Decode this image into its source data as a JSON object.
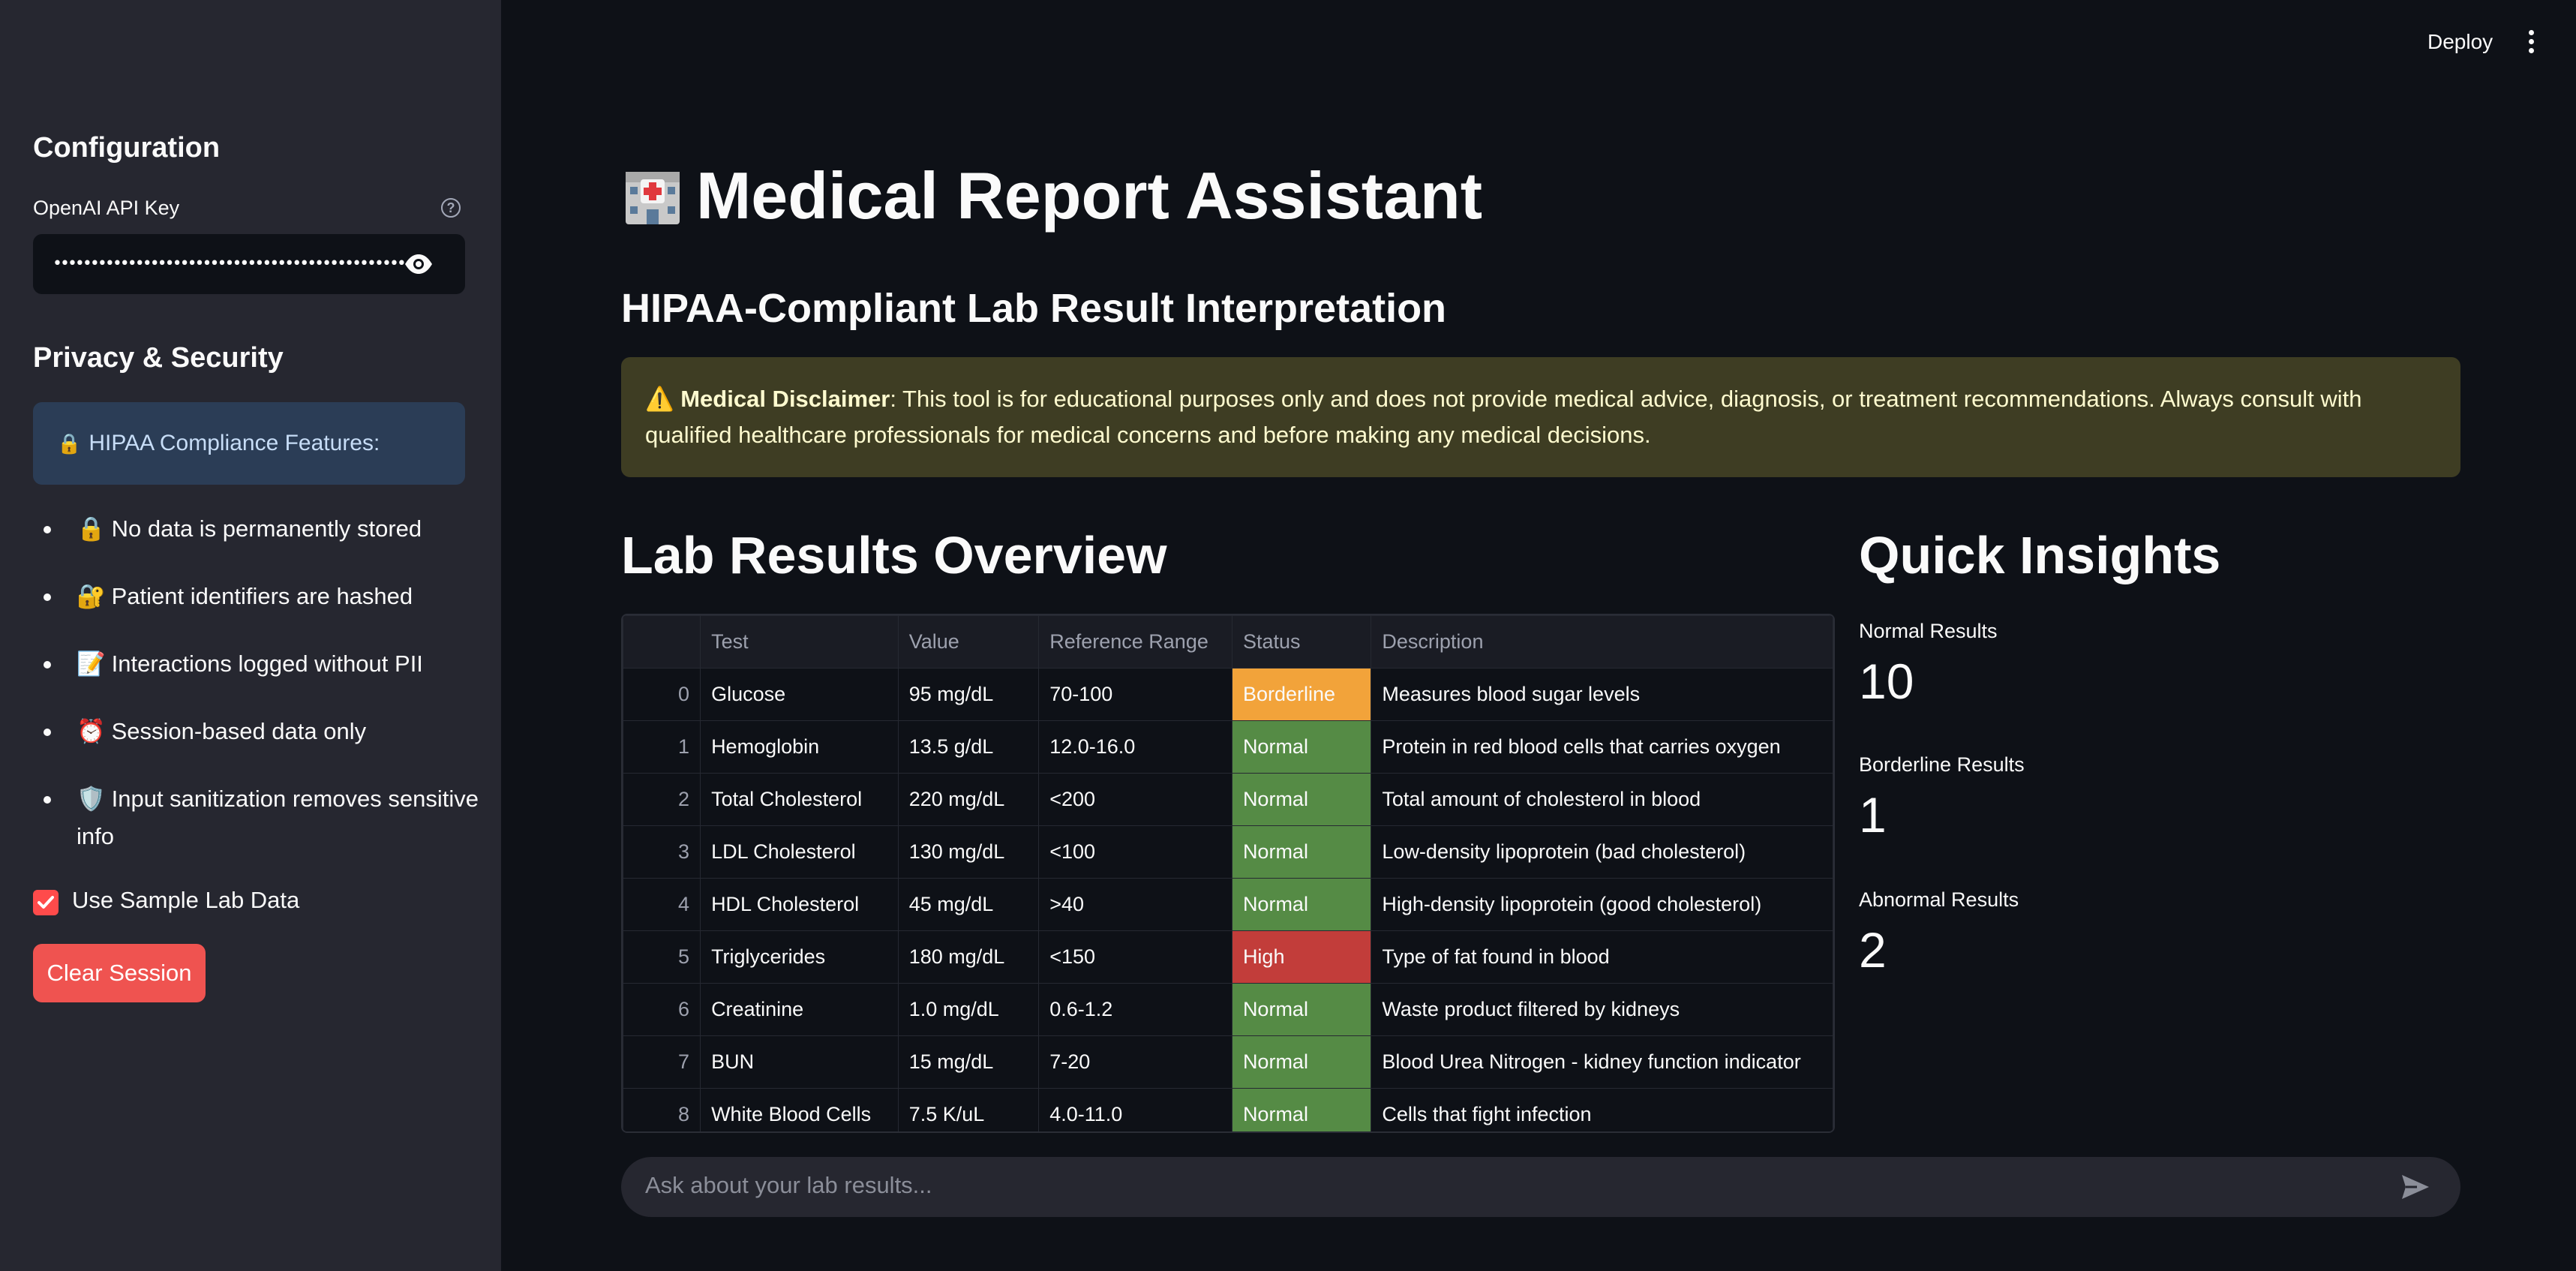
{
  "sidebar": {
    "config_heading": "Configuration",
    "api_key_label": "OpenAI API Key",
    "api_key_value": "••••••••••••••••••••••••••••••••••••••••••••••••••••••••••••••••",
    "privacy_heading": "Privacy & Security",
    "info_box_emoji": "🔒",
    "info_box_text": "HIPAA Compliance Features:",
    "features": [
      {
        "emoji": "🔒",
        "text": "No data is permanently stored"
      },
      {
        "emoji": "🔐",
        "text": "Patient identifiers are hashed"
      },
      {
        "emoji": "📝",
        "text": "Interactions logged without PII"
      },
      {
        "emoji": "⏰",
        "text": "Session-based data only"
      },
      {
        "emoji": "🛡️",
        "text": "Input sanitization removes sensitive info"
      }
    ],
    "checkbox_label": "Use Sample Lab Data",
    "checkbox_checked": true,
    "clear_button": "Clear Session"
  },
  "header": {
    "deploy": "Deploy"
  },
  "main": {
    "title": "Medical Report Assistant",
    "subtitle": "HIPAA-Compliant Lab Result Interpretation",
    "disclaimer_emoji": "⚠️",
    "disclaimer_bold": "Medical Disclaimer",
    "disclaimer_text": ": This tool is for educational purposes only and does not provide medical advice, diagnosis, or treatment recommendations. Always consult with qualified healthcare professionals for medical concerns and before making any medical decisions.",
    "lab_heading": "Lab Results Overview",
    "insights_heading": "Quick Insights",
    "chat_placeholder": "Ask about your lab results..."
  },
  "table": {
    "columns": [
      "",
      "Test",
      "Value",
      "Reference Range",
      "Status",
      "Description"
    ],
    "rows": [
      [
        "0",
        "Glucose",
        "95 mg/dL",
        "70-100",
        "Borderline",
        "Measures blood sugar levels"
      ],
      [
        "1",
        "Hemoglobin",
        "13.5 g/dL",
        "12.0-16.0",
        "Normal",
        "Protein in red blood cells that carries oxygen"
      ],
      [
        "2",
        "Total Cholesterol",
        "220 mg/dL",
        "<200",
        "Normal",
        "Total amount of cholesterol in blood"
      ],
      [
        "3",
        "LDL Cholesterol",
        "130 mg/dL",
        "<100",
        "Normal",
        "Low-density lipoprotein (bad cholesterol)"
      ],
      [
        "4",
        "HDL Cholesterol",
        "45 mg/dL",
        ">40",
        "Normal",
        "High-density lipoprotein (good cholesterol)"
      ],
      [
        "5",
        "Triglycerides",
        "180 mg/dL",
        "<150",
        "High",
        "Type of fat found in blood"
      ],
      [
        "6",
        "Creatinine",
        "1.0 mg/dL",
        "0.6-1.2",
        "Normal",
        "Waste product filtered by kidneys"
      ],
      [
        "7",
        "BUN",
        "15 mg/dL",
        "7-20",
        "Normal",
        "Blood Urea Nitrogen - kidney function indicator"
      ],
      [
        "8",
        "White Blood Cells",
        "7.5 K/uL",
        "4.0-11.0",
        "Normal",
        "Cells that fight infection"
      ]
    ]
  },
  "metrics": [
    {
      "label": "Normal Results",
      "value": "10"
    },
    {
      "label": "Borderline Results",
      "value": "1"
    },
    {
      "label": "Abnormal Results",
      "value": "2"
    }
  ],
  "colors": {
    "status_normal": "#558b45",
    "status_borderline": "#f2a33a",
    "status_high": "#c23d3a",
    "primary": "#ff4b4b"
  }
}
